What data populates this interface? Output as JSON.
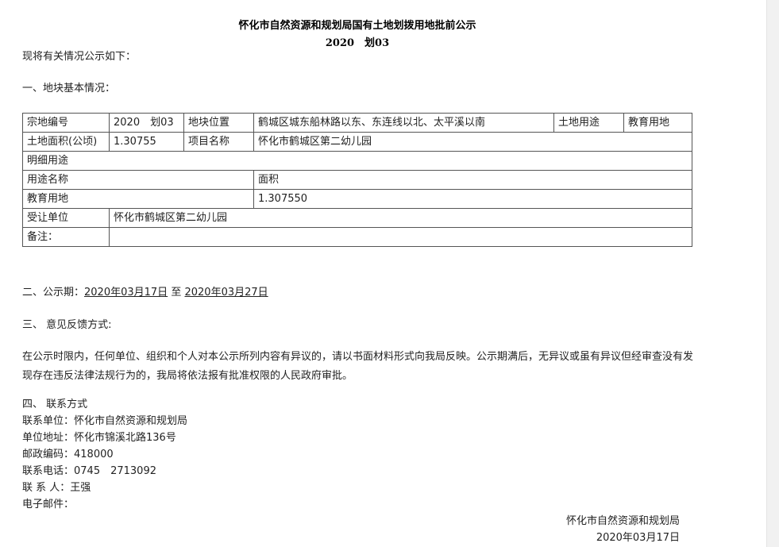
{
  "header": {
    "title": "怀化市自然资源和规划局国有土地划拨用地批前公示",
    "doc_number": "2020　划03"
  },
  "intro": "现将有关情况公示如下：",
  "section1_title": "一、地块基本情况：",
  "table": {
    "r1": {
      "l1": "宗地编号",
      "v1": "2020　划03",
      "l2": "地块位置",
      "v2": "鹤城区城东船林路以东、东连线以北、太平溪以南",
      "l3": "土地用途",
      "v3": "教育用地"
    },
    "r2": {
      "l1": "土地面积(公顷)",
      "v1": "1.30755",
      "l2": "项目名称",
      "v2": "怀化市鹤城区第二幼儿园"
    },
    "r3": {
      "label": "明细用途"
    },
    "r4": {
      "c1": "用途名称",
      "c2": "面积"
    },
    "r5": {
      "c1": "教育用地",
      "c2": "1.307550"
    },
    "r6": {
      "label": "受让单位",
      "value": "怀化市鹤城区第二幼儿园"
    },
    "r7": {
      "label": "备注：",
      "value": ""
    }
  },
  "period": {
    "label": "二、公示期：",
    "start": "2020年03月17日",
    "to": "至",
    "end": "2020年03月27日"
  },
  "section3_title": "三、 意见反馈方式:",
  "feedback_text": "在公示时限内，任何单位、组织和个人对本公示所列内容有异议的，请以书面材料形式向我局反映。公示期满后，无异议或虽有异议但经审查没有发现存在违反法律法规行为的，我局将依法报有批准权限的人民政府审批。",
  "contact": {
    "title": "四、 联系方式",
    "unit": "联系单位：怀化市自然资源和规划局",
    "address": "单位地址：怀化市锦溪北路136号",
    "postcode": "邮政编码：418000",
    "phone": "联系电话：0745　2713092",
    "person": "联 系 人：王强",
    "email": "电子邮件："
  },
  "footer": {
    "org": "怀化市自然资源和规划局",
    "date": "2020年03月17日"
  }
}
